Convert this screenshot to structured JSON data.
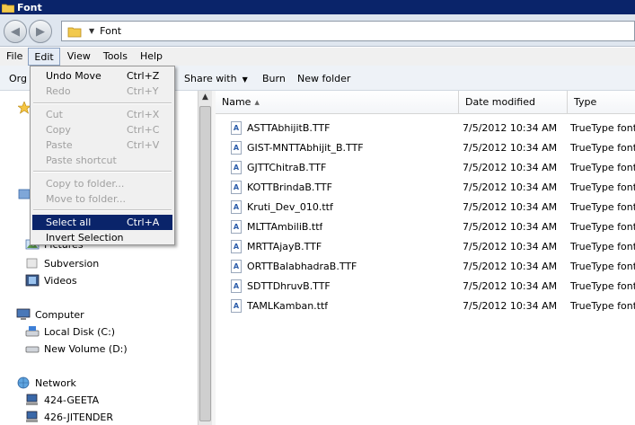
{
  "window": {
    "title": "Font"
  },
  "address": {
    "path": "Font"
  },
  "menubar": {
    "items": [
      "File",
      "Edit",
      "View",
      "Tools",
      "Help"
    ]
  },
  "toolbar": {
    "organize": "Org",
    "share_with": "Share with",
    "burn": "Burn",
    "new_folder": "New folder"
  },
  "edit_menu": {
    "undo": {
      "label": "Undo Move",
      "shortcut": "Ctrl+Z"
    },
    "redo": {
      "label": "Redo",
      "shortcut": "Ctrl+Y"
    },
    "cut": {
      "label": "Cut",
      "shortcut": "Ctrl+X"
    },
    "copy": {
      "label": "Copy",
      "shortcut": "Ctrl+C"
    },
    "paste": {
      "label": "Paste",
      "shortcut": "Ctrl+V"
    },
    "paste_shortcut": {
      "label": "Paste shortcut"
    },
    "copy_to_folder": {
      "label": "Copy to folder..."
    },
    "move_to_folder": {
      "label": "Move to folder..."
    },
    "select_all": {
      "label": "Select all",
      "shortcut": "Ctrl+A"
    },
    "invert_selection": {
      "label": "Invert Selection"
    }
  },
  "nav_pane": {
    "libraries": {
      "pictures": "Pictures",
      "subversion": "Subversion",
      "videos": "Videos"
    },
    "computer": {
      "label": "Computer",
      "local_disk": "Local Disk (C:)",
      "new_volume": "New Volume (D:)"
    },
    "network": {
      "label": "Network",
      "hosts": [
        "424-GEETA",
        "426-JITENDER"
      ]
    }
  },
  "file_list": {
    "columns": [
      "Name",
      "Date modified",
      "Type"
    ],
    "rows": [
      {
        "name": "ASTTAbhijitB.TTF",
        "date": "7/5/2012 10:34 AM",
        "type": "TrueType font"
      },
      {
        "name": "GIST-MNTTAbhijit_B.TTF",
        "date": "7/5/2012 10:34 AM",
        "type": "TrueType font"
      },
      {
        "name": "GJTTChitraB.TTF",
        "date": "7/5/2012 10:34 AM",
        "type": "TrueType font"
      },
      {
        "name": "KOTTBrindaB.TTF",
        "date": "7/5/2012 10:34 AM",
        "type": "TrueType font"
      },
      {
        "name": "Kruti_Dev_010.ttf",
        "date": "7/5/2012 10:34 AM",
        "type": "TrueType font"
      },
      {
        "name": "MLTTAmbiliB.ttf",
        "date": "7/5/2012 10:34 AM",
        "type": "TrueType font"
      },
      {
        "name": "MRTTAjayB.TTF",
        "date": "7/5/2012 10:34 AM",
        "type": "TrueType font"
      },
      {
        "name": "ORTTBalabhadraB.TTF",
        "date": "7/5/2012 10:34 AM",
        "type": "TrueType font"
      },
      {
        "name": "SDTTDhruvB.TTF",
        "date": "7/5/2012 10:34 AM",
        "type": "TrueType font"
      },
      {
        "name": "TAMLKamban.ttf",
        "date": "7/5/2012 10:34 AM",
        "type": "TrueType font"
      }
    ]
  },
  "colors": {
    "titlebar": "#0a246a",
    "highlight": "#0a246a",
    "disabled_text": "#a0a0a0"
  }
}
